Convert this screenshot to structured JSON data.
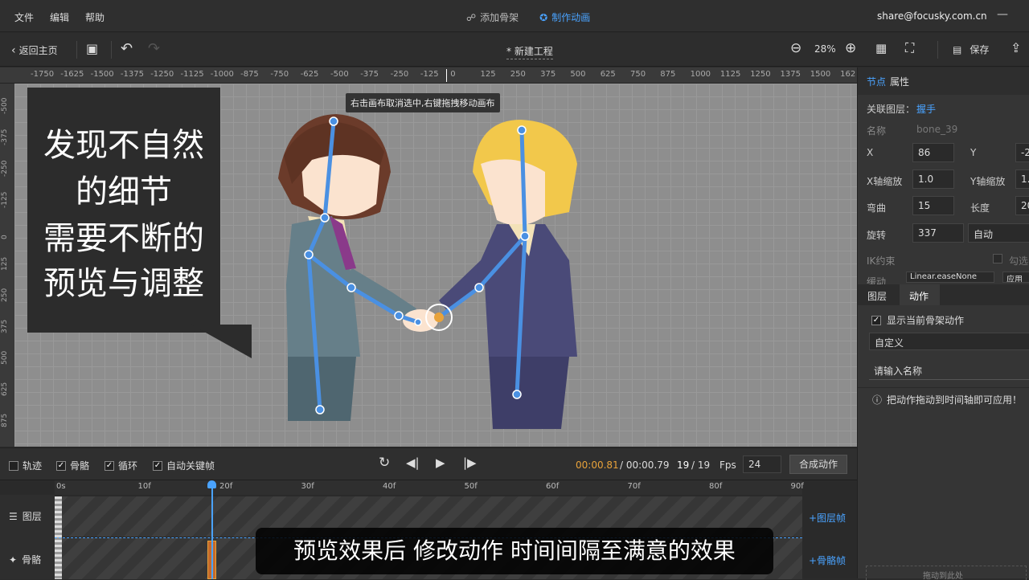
{
  "menu": {
    "file": "文件",
    "edit": "编辑",
    "help": "帮助"
  },
  "modes": {
    "add_skeleton": "添加骨架",
    "make_animation": "制作动画"
  },
  "account": {
    "email": "share@focusky.com.cn"
  },
  "toolbar": {
    "back_home": "返回主页",
    "project_title": "* 新建工程",
    "zoom": "28%",
    "save": "保存"
  },
  "hruler": {
    "ticks": [
      "-1750",
      "-1625",
      "-1500",
      "-1375",
      "-1250",
      "-1125",
      "-1000",
      "-875",
      "-750",
      "-625",
      "-500",
      "-375",
      "-250",
      "-125",
      "0",
      "125",
      "250",
      "375",
      "500",
      "625",
      "750",
      "875",
      "1000",
      "1125",
      "1250",
      "1375",
      "1500",
      "162"
    ]
  },
  "vruler": {
    "ticks": [
      "-500",
      "-375",
      "-250",
      "-125",
      "0",
      "125",
      "250",
      "375",
      "500",
      "625",
      "875"
    ]
  },
  "canvas": {
    "tooltip": "右击画布取消选中,右键拖拽移动画布",
    "callout_lines": [
      "发现不自然",
      "的细节",
      "需要不断的",
      "预览与调整"
    ]
  },
  "panel": {
    "tab_node": "节点",
    "tab_props": "属性",
    "linked_layer_label": "关联图层：",
    "linked_layer_value": "握手",
    "name_label": "名称",
    "name_value": "bone_39",
    "x_label": "X",
    "x_value": "86",
    "y_label": "Y",
    "y_value": "-2",
    "xscale_label": "X轴缩放",
    "xscale_value": "1.0",
    "yscale_label": "Y轴缩放",
    "yscale_value": "1.",
    "bend_label": "弯曲",
    "bend_value": "15",
    "length_label": "长度",
    "length_value": "20",
    "rotate_label": "旋转",
    "rotate_value": "337",
    "rotate_mode": "自动",
    "ik_label": "IK约束",
    "ik_check_label": "勾选",
    "easing_label": "缓动",
    "easing_value": "Linear.easeNone",
    "apply_label": "应用",
    "tab_layer": "图层",
    "tab_action": "动作",
    "show_action_label": "显示当前骨架动作",
    "custom_select": "自定义",
    "name_placeholder": "请输入名称",
    "hint": "把动作拖动到时间轴即可应用！",
    "bottom_hint": "拖动到此处删除"
  },
  "playbar": {
    "track": "轨迹",
    "skeleton": "骨骼",
    "loop": "循环",
    "auto_key": "自动关键帧",
    "time_current": "00:00.81",
    "time_total": "/ 00:00.79",
    "frame_current": "19",
    "frame_total": "/ 19",
    "fps_label": "Fps",
    "fps_value": "24",
    "compose": "合成动作"
  },
  "timeline": {
    "frame_ticks": [
      "0s",
      "10f",
      "20f",
      "30f",
      "40f",
      "50f",
      "60f",
      "70f",
      "80f",
      "90f"
    ],
    "layer_label": "图层",
    "bone_label": "骨骼",
    "add_layer_frame": "+图层帧",
    "add_bone_frame": "+骨骼帧"
  },
  "subtitle": "预览效果后 修改动作 时间间隔至满意的效果",
  "colors": {
    "accent": "#4aa3ff",
    "orange": "#e8a23a",
    "bone": "#4a90e2"
  }
}
